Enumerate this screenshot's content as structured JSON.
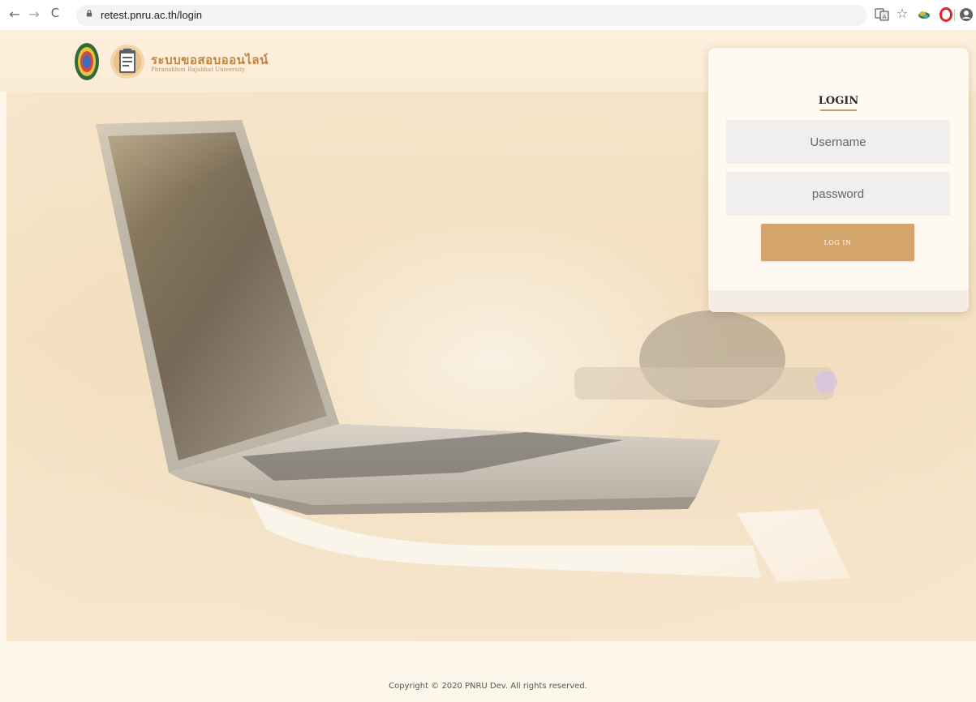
{
  "browser": {
    "url": "retest.pnru.ac.th/login",
    "icons": [
      "back-arrow-icon",
      "forward-arrow-icon",
      "reload-icon",
      "lock-icon",
      "translate-icon",
      "star-icon",
      "extension-icon",
      "opera-icon",
      "profile-icon"
    ],
    "back_glyph": "←",
    "forward_glyph": "→",
    "reload_glyph": "C",
    "star_glyph": "☆"
  },
  "header": {
    "title": "ระบบขอสอบออนไลน์",
    "subtitle": "Phranakhon Rajabhat University"
  },
  "login": {
    "title": "LOGIN",
    "username_placeholder": "Username",
    "password_placeholder": "password",
    "button_label": "LOG IN"
  },
  "footer": {
    "copyright": "Copyright © 2020 PNRU Dev. All rights reserved."
  },
  "colors": {
    "accent": "#d4a46d",
    "brand_text": "#c0843f",
    "page_background": "#fdf6ea"
  }
}
